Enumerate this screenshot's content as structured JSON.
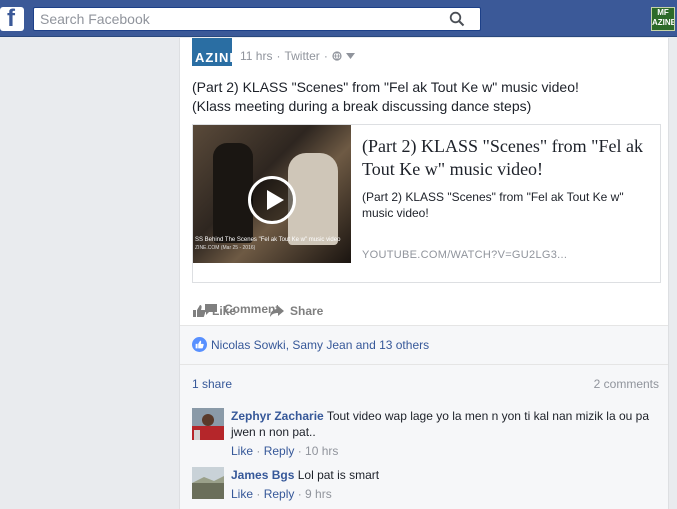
{
  "topbar": {
    "logo_letter": "f",
    "search_placeholder": "Search Facebook",
    "corner_logo_text": "MF AZINE"
  },
  "post": {
    "avatar_text": "AZINE",
    "time": "11 hrs",
    "source": "Twitter",
    "text_line1": "(Part 2) KLASS \"Scenes\" from \"Fel ak Tout Ke w\" music video!",
    "text_line2": "(Klass meeting during a break discussing dance steps)",
    "link": {
      "title": "(Part 2) KLASS \"Scenes\" from \"Fel ak Tout Ke w\" music video!",
      "description": "(Part 2) KLASS \"Scenes\" from \"Fel ak Tout Ke w\" music video!",
      "url": "YOUTUBE.COM/WATCH?V=GU2LG3...",
      "thumb_caption": "SS Behind The Scenes \"Fel ak Tout Ke w\" music video",
      "thumb_caption2": "ZINE.COM (Mar 25 - 2016)"
    },
    "actions": {
      "like": "Like",
      "comment": "Comment",
      "share": "Share"
    },
    "likes_text": "Nicolas Sowki, Samy Jean and 13 others",
    "shares": "1 share",
    "comments_count": "2 comments"
  },
  "comments": [
    {
      "name": "Zephyr Zacharie",
      "text": "Tout video wap lage yo la men n yon ti kal nan mizik la ou pa jwen n non pat..",
      "like": "Like",
      "reply": "Reply",
      "time": "10 hrs"
    },
    {
      "name": "James Bgs",
      "text": "Lol pat is smart",
      "like": "Like",
      "reply": "Reply",
      "time": "9 hrs"
    }
  ],
  "colors": {
    "brand": "#3b5998",
    "link": "#365899",
    "muted": "#90949c"
  }
}
